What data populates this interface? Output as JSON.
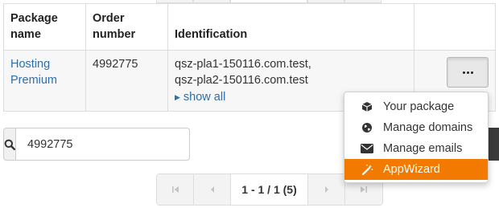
{
  "table": {
    "headers": {
      "package": "Package name",
      "order": "Order number",
      "identification": "Identification"
    },
    "row": {
      "package_name": "Hosting Premium",
      "order_number": "4992775",
      "identifications": [
        "qsz-pla1-150116.com.test,",
        "qsz-pla2-150116.com.test"
      ],
      "show_all": "show all"
    }
  },
  "actions_menu": {
    "items": [
      {
        "label": "Your package",
        "icon": "box-icon"
      },
      {
        "label": "Manage domains",
        "icon": "globe-icon"
      },
      {
        "label": "Manage emails",
        "icon": "envelope-icon"
      },
      {
        "label": "AppWizard",
        "icon": "magic-wand-icon",
        "active": true
      }
    ],
    "active_color": "#f27a00"
  },
  "search": {
    "value": "4992775"
  },
  "pagination": {
    "info": "1 - 1 / 1 (5)"
  },
  "colors": {
    "link": "#2a6fb0",
    "accent": "#f27a00"
  }
}
